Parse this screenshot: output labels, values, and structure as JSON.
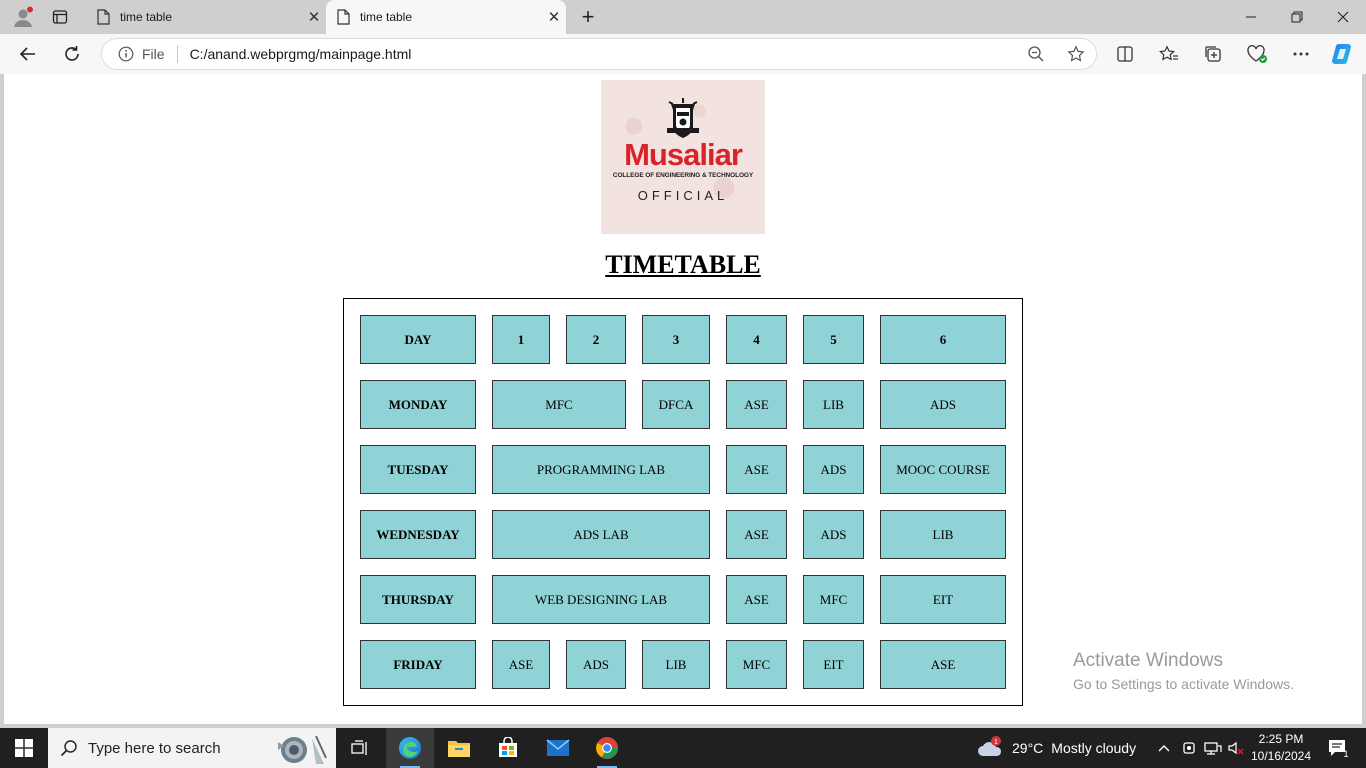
{
  "browser": {
    "tabs": [
      {
        "title": "time table"
      },
      {
        "title": "time table"
      }
    ],
    "address": {
      "site_label": "File",
      "url": "C:/anand.webprgmg/mainpage.html"
    }
  },
  "page": {
    "logo": {
      "name": "Musaliar",
      "subtitle": "COLLEGE OF ENGINEERING & TECHNOLOGY",
      "tagline": "OFFICIAL"
    },
    "title": "TIMETABLE",
    "timetable": {
      "header": [
        "DAY",
        "1",
        "2",
        "3",
        "4",
        "5",
        "6"
      ],
      "rows": [
        {
          "day": "MONDAY",
          "cells": [
            "MFC",
            "DFCA",
            "ASE",
            "LIB",
            "ADS"
          ]
        },
        {
          "day": "TUESDAY",
          "cells": [
            "PROGRAMMING LAB",
            "ASE",
            "ADS",
            "MOOC COURSE"
          ]
        },
        {
          "day": "WEDNESDAY",
          "cells": [
            "ADS LAB",
            "ASE",
            "ADS",
            "LIB"
          ]
        },
        {
          "day": "THURSDAY",
          "cells": [
            "WEB DESIGNING LAB",
            "ASE",
            "MFC",
            "EIT"
          ]
        },
        {
          "day": "FRIDAY",
          "cells": [
            "ASE",
            "ADS",
            "LIB",
            "MFC",
            "EIT",
            "ASE"
          ]
        }
      ]
    }
  },
  "watermark": {
    "line1": "Activate Windows",
    "line2": "Go to Settings to activate Windows."
  },
  "taskbar": {
    "search_placeholder": "Type here to search",
    "weather": {
      "temp": "29°C",
      "condition": "Mostly cloudy",
      "badge": "1"
    },
    "time": "2:25 PM",
    "date": "10/16/2024",
    "notifications": "1"
  },
  "colors": {
    "cell_bg": "#8fd3d6",
    "logo_red": "#d8232a",
    "taskbar_bg": "#202020"
  }
}
